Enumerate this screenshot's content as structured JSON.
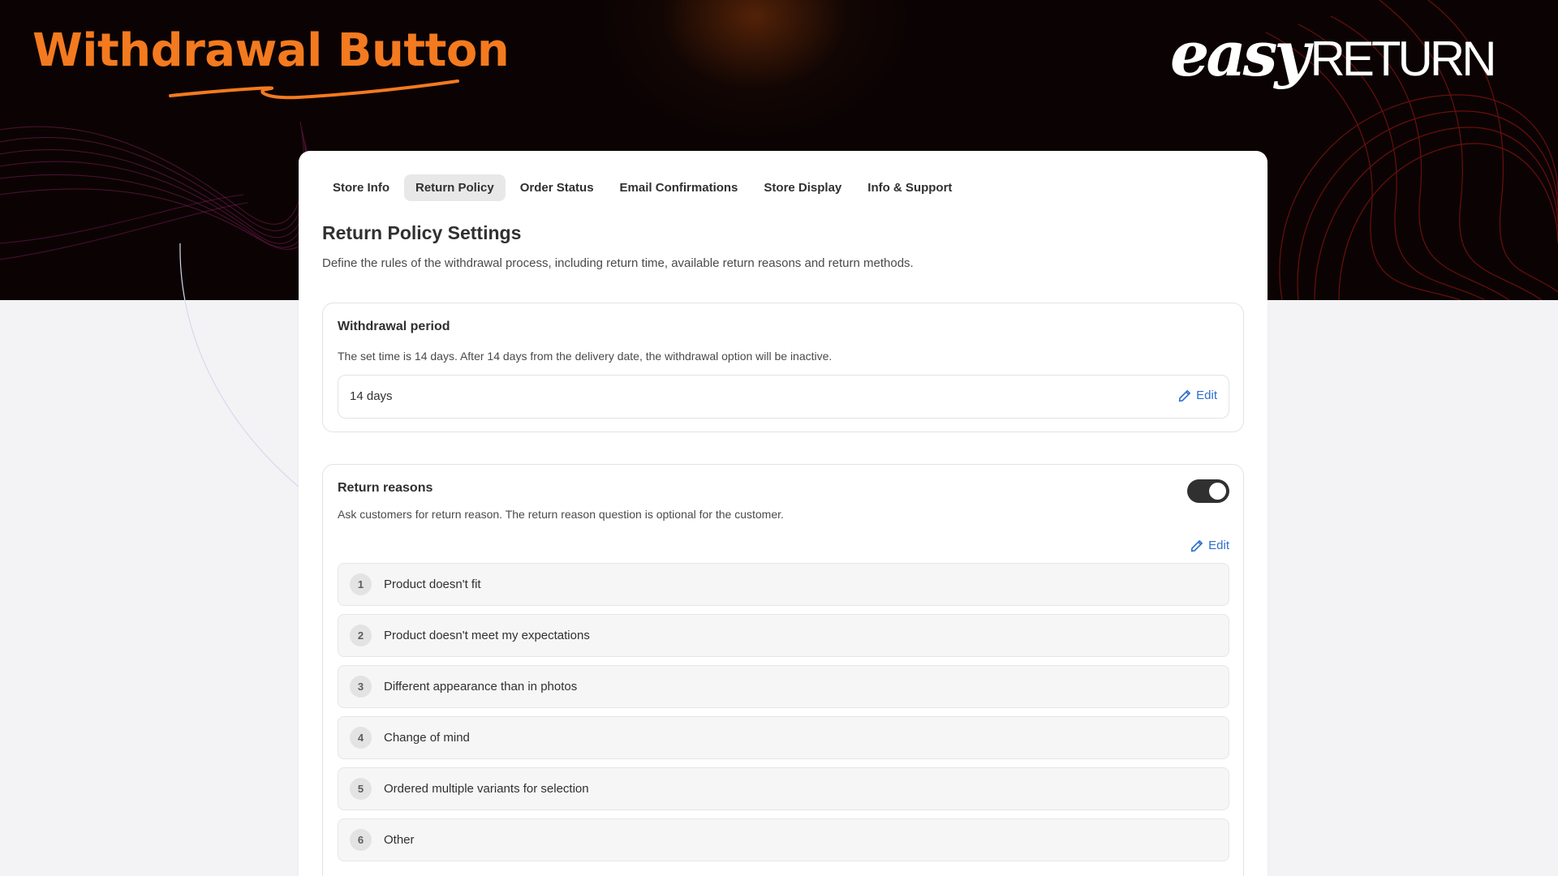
{
  "hero": {
    "title": "Withdrawal Button",
    "brand_part1": "easy",
    "brand_part2": "RETURN"
  },
  "colors": {
    "accent_orange": "#f47a1f",
    "link_blue": "#2c6ecb",
    "toggle_on": "#303030"
  },
  "tabs": [
    {
      "label": "Store Info",
      "active": false
    },
    {
      "label": "Return Policy",
      "active": true
    },
    {
      "label": "Order Status",
      "active": false
    },
    {
      "label": "Email Confirmations",
      "active": false
    },
    {
      "label": "Store Display",
      "active": false
    },
    {
      "label": "Info & Support",
      "active": false
    }
  ],
  "settings": {
    "title": "Return Policy Settings",
    "description": "Define the rules of the withdrawal process, including return time, available return reasons and return methods."
  },
  "withdrawal_period": {
    "heading": "Withdrawal period",
    "description": "The set time is 14 days. After 14 days from the delivery date, the withdrawal option will be inactive.",
    "value": "14 days",
    "edit_label": "Edit",
    "edit_icon": "pencil-icon"
  },
  "return_reasons": {
    "heading": "Return reasons",
    "description": "Ask customers for return reason. The return reason question is optional for the customer.",
    "enabled": true,
    "edit_label": "Edit",
    "edit_icon": "pencil-icon",
    "items": [
      {
        "num": "1",
        "label": "Product doesn't fit"
      },
      {
        "num": "2",
        "label": "Product doesn't meet my expectations"
      },
      {
        "num": "3",
        "label": "Different appearance than in photos"
      },
      {
        "num": "4",
        "label": "Change of mind"
      },
      {
        "num": "5",
        "label": "Ordered multiple variants for selection"
      },
      {
        "num": "6",
        "label": "Other"
      }
    ]
  }
}
